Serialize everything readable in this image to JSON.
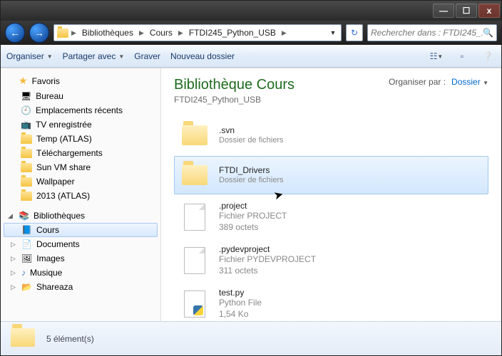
{
  "breadcrumbs": [
    "Bibliothèques",
    "Cours",
    "FTDI245_Python_USB"
  ],
  "search_placeholder": "Rechercher dans : FTDI245_...",
  "toolbar": {
    "organize": "Organiser",
    "share": "Partager avec",
    "burn": "Graver",
    "new_folder": "Nouveau dossier"
  },
  "sidebar": {
    "favorites_label": "Favoris",
    "favorites": [
      {
        "label": "Bureau"
      },
      {
        "label": "Emplacements récents"
      },
      {
        "label": "TV enregistrée"
      },
      {
        "label": "Temp (ATLAS)"
      },
      {
        "label": "Téléchargements"
      },
      {
        "label": "Sun VM share"
      },
      {
        "label": "Wallpaper"
      },
      {
        "label": "2013 (ATLAS)"
      }
    ],
    "libraries_label": "Bibliothèques",
    "libraries": [
      {
        "label": "Cours",
        "selected": true
      },
      {
        "label": "Documents"
      },
      {
        "label": "Images"
      },
      {
        "label": "Musique"
      },
      {
        "label": "Shareaza"
      }
    ]
  },
  "header": {
    "title": "Bibliothèque Cours",
    "subtitle": "FTDI245_Python_USB",
    "organize_by": "Organiser par :",
    "organize_val": "Dossier"
  },
  "files": [
    {
      "name": ".svn",
      "desc": "Dossier de fichiers",
      "type": "folder"
    },
    {
      "name": "FTDI_Drivers",
      "desc": "Dossier de fichiers",
      "type": "folder",
      "selected": true
    },
    {
      "name": ".project",
      "desc": "Fichier PROJECT",
      "size": "389 octets",
      "type": "file"
    },
    {
      "name": ".pydevproject",
      "desc": "Fichier PYDEVPROJECT",
      "size": "311 octets",
      "type": "file"
    },
    {
      "name": "test.py",
      "desc": "Python File",
      "size": "1,54 Ko",
      "type": "python"
    }
  ],
  "status": "5 élément(s)"
}
